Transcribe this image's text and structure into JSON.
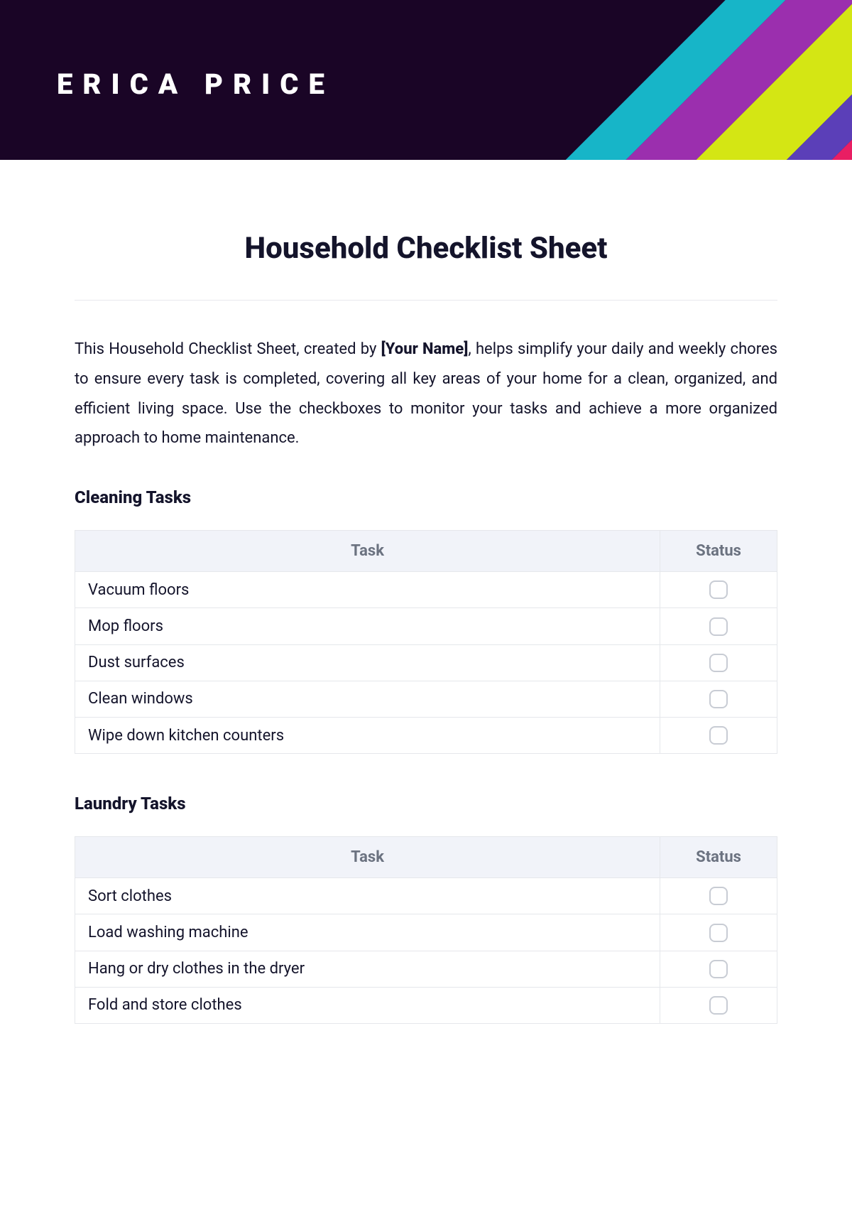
{
  "header": {
    "name": "ERICA PRICE"
  },
  "title": "Household Checklist Sheet",
  "intro": {
    "prefix": "This Household Checklist Sheet, created by ",
    "placeholder": "[Your Name]",
    "suffix": ", helps simplify your daily and weekly chores to ensure every task is completed, covering all key areas of your home for a clean, organized, and efficient living space. Use the checkboxes to monitor your tasks and achieve a more organized approach to home maintenance."
  },
  "columns": {
    "task": "Task",
    "status": "Status"
  },
  "sections": [
    {
      "heading": "Cleaning Tasks",
      "rows": [
        {
          "task": "Vacuum floors"
        },
        {
          "task": "Mop floors"
        },
        {
          "task": "Dust surfaces"
        },
        {
          "task": "Clean windows"
        },
        {
          "task": "Wipe down kitchen counters"
        }
      ]
    },
    {
      "heading": "Laundry Tasks",
      "rows": [
        {
          "task": "Sort clothes"
        },
        {
          "task": "Load washing machine"
        },
        {
          "task": "Hang or dry clothes in the dryer"
        },
        {
          "task": "Fold and store clothes"
        }
      ]
    }
  ]
}
